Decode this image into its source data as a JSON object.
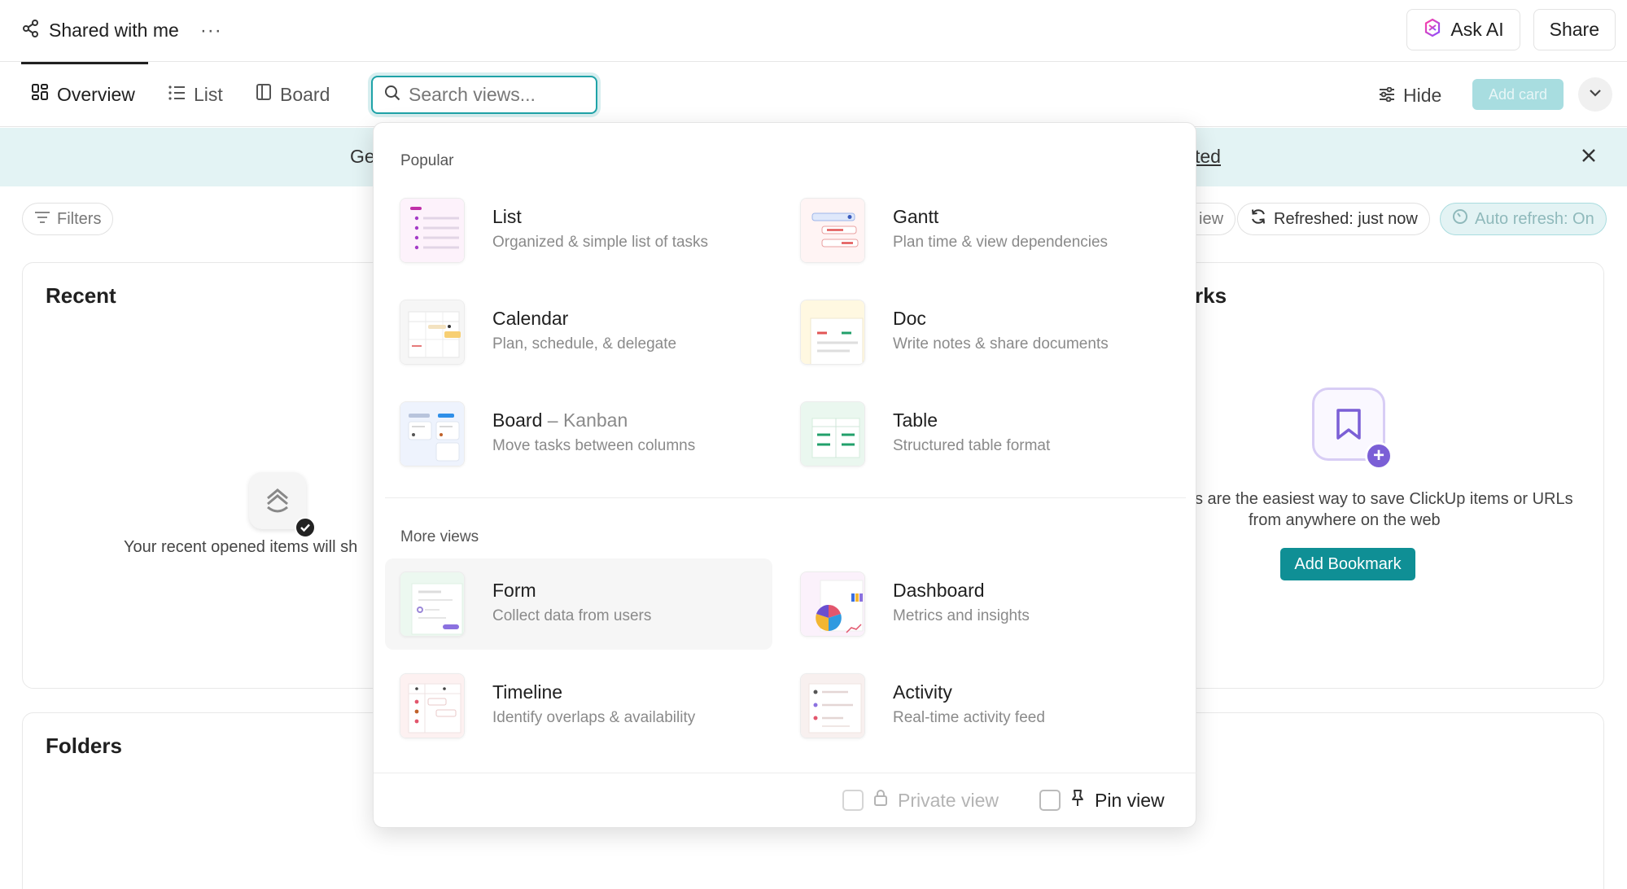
{
  "header": {
    "title": "Shared with me",
    "more": "···",
    "ask_ai": "Ask AI",
    "share": "Share"
  },
  "tabs": [
    {
      "label": "Overview",
      "active": true
    },
    {
      "label": "List",
      "active": false
    },
    {
      "label": "Board",
      "active": false
    }
  ],
  "search": {
    "placeholder": "Search views...",
    "value": ""
  },
  "toolbar": {
    "hide_label": "Hide",
    "add_card_label": "Add card"
  },
  "banner": {
    "lead": "Ge",
    "link": "ted"
  },
  "filters": {
    "filters_label": "Filters",
    "view_partial": "iew",
    "refreshed_label": "Refreshed: just now",
    "auto_refresh_label": "Auto refresh: On"
  },
  "recent": {
    "title": "Recent",
    "empty_text": "Your recent opened items will sh"
  },
  "bookmarks": {
    "title_partial": "rks",
    "text_line1": "s are the easiest way to save ClickUp items or URLs",
    "text_line2": "from anywhere on the web",
    "button_label": "Add Bookmark"
  },
  "folders": {
    "title": "Folders"
  },
  "dropdown": {
    "popular_label": "Popular",
    "more_label": "More views",
    "popular": [
      {
        "title": "List",
        "subtitle": "",
        "desc": "Organized & simple list of tasks"
      },
      {
        "title": "Gantt",
        "subtitle": "",
        "desc": "Plan time & view dependencies"
      },
      {
        "title": "Calendar",
        "subtitle": "",
        "desc": "Plan, schedule, & delegate"
      },
      {
        "title": "Doc",
        "subtitle": "",
        "desc": "Write notes & share documents"
      },
      {
        "title": "Board",
        "subtitle": "– Kanban",
        "desc": "Move tasks between columns"
      },
      {
        "title": "Table",
        "subtitle": "",
        "desc": "Structured table format"
      }
    ],
    "more": [
      {
        "title": "Form",
        "desc": "Collect data from users"
      },
      {
        "title": "Dashboard",
        "desc": "Metrics and insights"
      },
      {
        "title": "Timeline",
        "desc": "Identify overlaps & availability"
      },
      {
        "title": "Activity",
        "desc": "Real-time activity feed"
      }
    ],
    "footer": {
      "private_label": "Private view",
      "pin_label": "Pin view"
    }
  },
  "colors": {
    "accent": "#1fa3a8",
    "button": "#0f8f95",
    "banner_bg": "#e3f3f4",
    "bookmark_purple": "#7b5fd6"
  }
}
